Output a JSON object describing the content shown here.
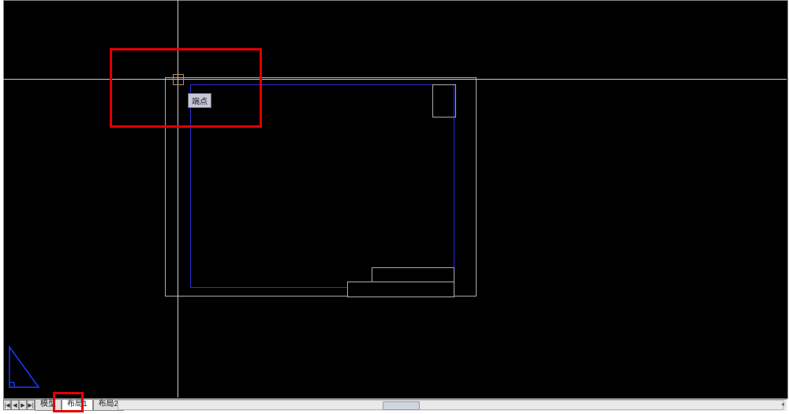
{
  "tooltip": {
    "text": "端点"
  },
  "tabs": {
    "model": "模型",
    "layout1": "布局1",
    "layout2": "布局2"
  },
  "nav": {
    "first": "|◀",
    "prev": "◀",
    "next": "▶",
    "last": "▶|"
  },
  "right_marker": "◂"
}
